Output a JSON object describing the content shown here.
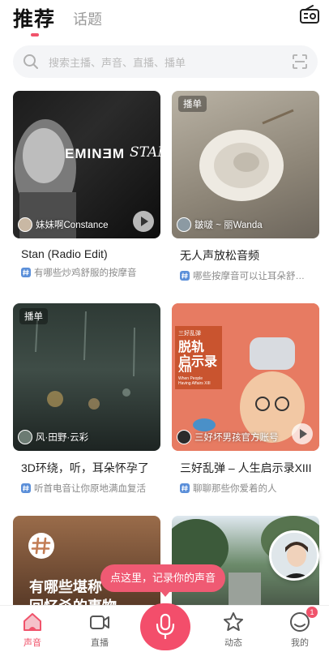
{
  "header": {
    "tab_recommend": "推荐",
    "tab_topic": "话题",
    "radio_icon": "radio-icon"
  },
  "search": {
    "placeholder": "搜索主播、声音、直播、播单",
    "icon": "search-icon",
    "scan_icon": "scan-icon"
  },
  "cards": [
    {
      "cover_text_1": "EMINƎM",
      "cover_text_2": "STAN",
      "author": "妹妹啊Constance",
      "title": "Stan (Radio Edit)",
      "topic": "有哪些炒鸡舒服的按摩音"
    },
    {
      "tag": "播单",
      "author": "皺啵 ~ 丽Wanda",
      "title": "无人声放松音频",
      "topic": "哪些按摩音可以让耳朵舒适..."
    },
    {
      "tag": "播单",
      "author": "风·田野·云彩",
      "title": "3D环绕，听，耳朵怀孕了",
      "topic": "听首电音让你原地满血复活"
    },
    {
      "cover_small": "三好乱弹",
      "cover_title_1": "脱轨",
      "cover_title_2": "启示录",
      "cover_title_3": "XIII",
      "cover_sub_1": "When People",
      "cover_sub_2": "Having Affairs XIII",
      "author": "三好坏男孩官方账号",
      "title": "三好乱弹 – 人生启示录XIII",
      "topic": "聊聊那些你爱着的人"
    },
    {
      "cover_text_1": "有哪些堪称",
      "cover_text_2": "回忆杀的事物"
    },
    {}
  ],
  "record_tip": "点这里，记录你的声音",
  "nav": {
    "items": [
      {
        "label": "声音",
        "icon": "home-sound-icon"
      },
      {
        "label": "直播",
        "icon": "live-camera-icon"
      },
      {
        "label": "",
        "icon": "mic-icon"
      },
      {
        "label": "动态",
        "icon": "star-icon"
      },
      {
        "label": "我的",
        "icon": "profile-icon"
      }
    ],
    "badge": "1"
  },
  "colors": {
    "accent": "#f0536b",
    "mic": "#f34e6b"
  }
}
